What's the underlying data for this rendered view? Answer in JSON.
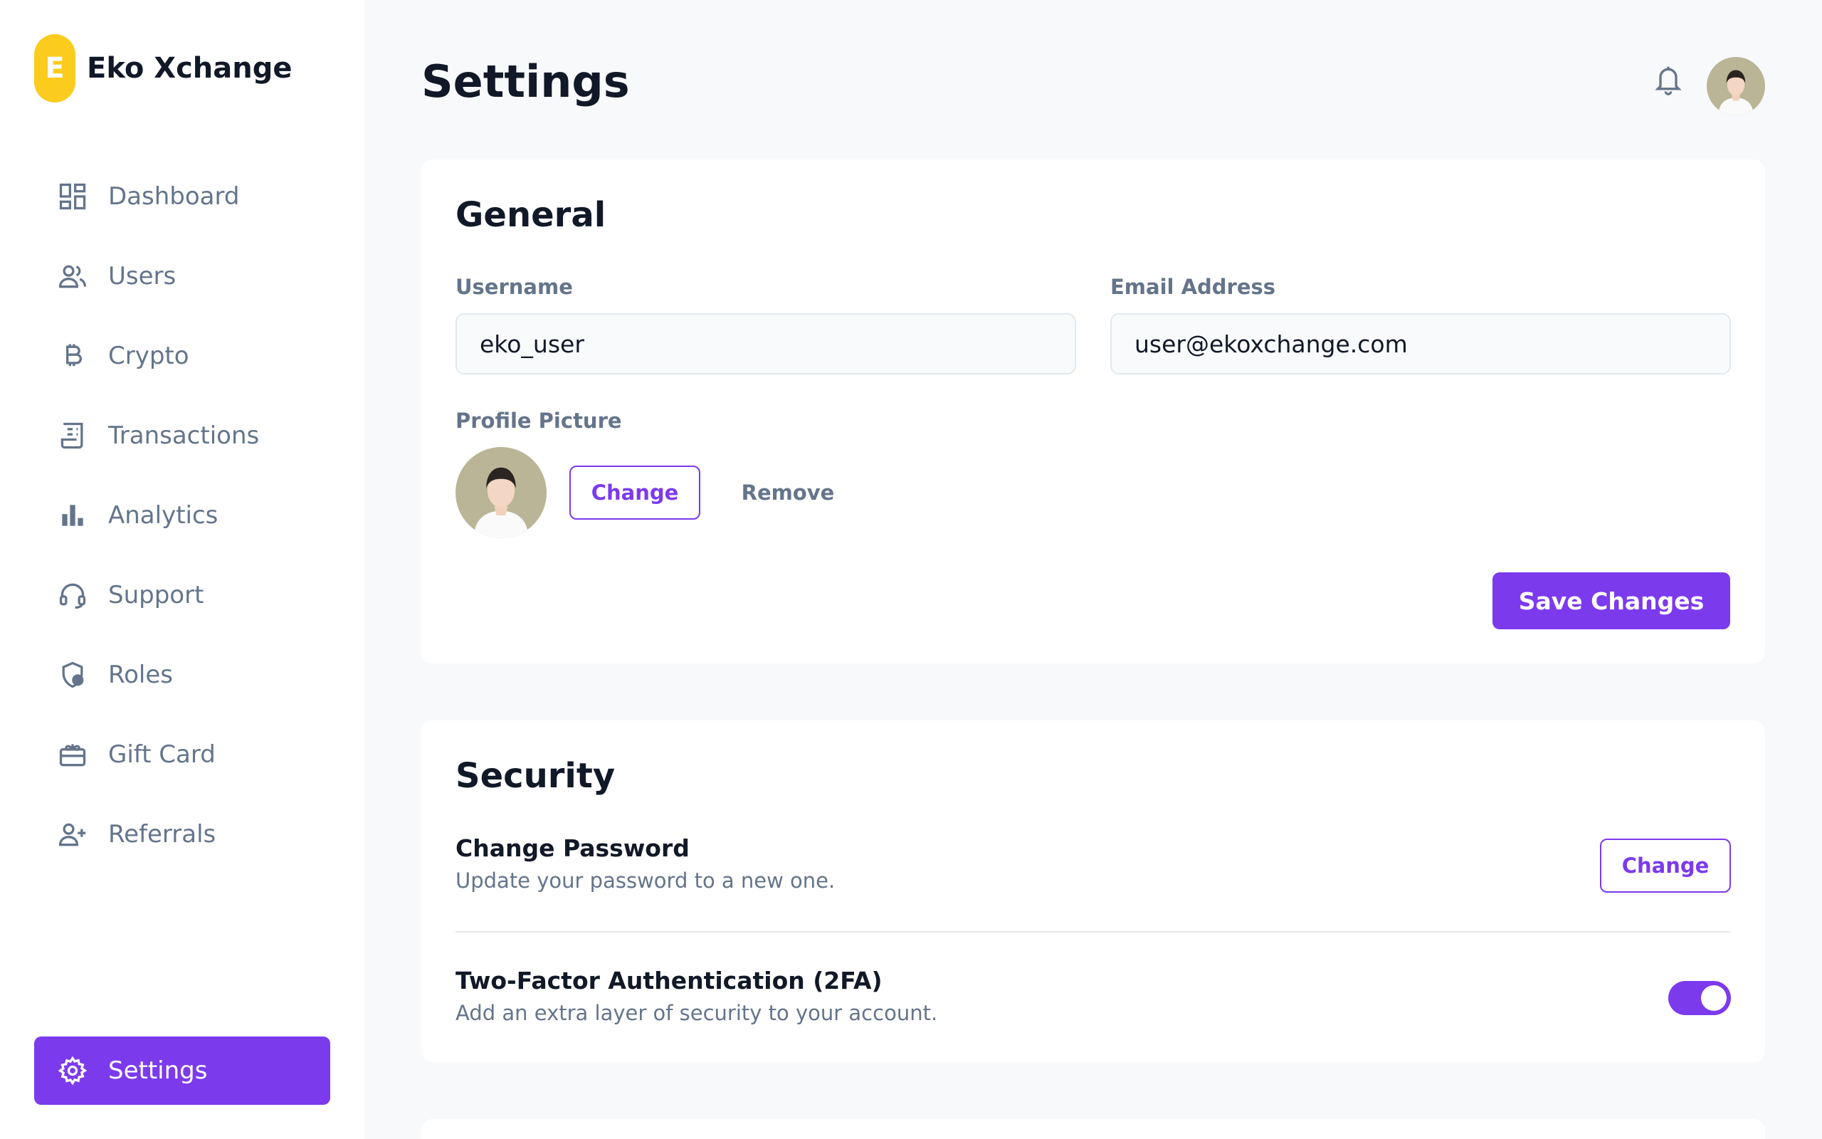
{
  "app": {
    "logo_letter": "E",
    "name": "Eko Xchange"
  },
  "sidebar": {
    "items": [
      {
        "label": "Dashboard",
        "icon": "dashboard-icon"
      },
      {
        "label": "Users",
        "icon": "users-icon"
      },
      {
        "label": "Crypto",
        "icon": "bitcoin-icon"
      },
      {
        "label": "Transactions",
        "icon": "receipt-icon"
      },
      {
        "label": "Analytics",
        "icon": "bar-chart-icon"
      },
      {
        "label": "Support",
        "icon": "headset-icon"
      },
      {
        "label": "Roles",
        "icon": "shield-user-icon"
      },
      {
        "label": "Gift Card",
        "icon": "gift-card-icon"
      },
      {
        "label": "Referrals",
        "icon": "user-plus-icon"
      }
    ],
    "active": {
      "label": "Settings",
      "icon": "gear-icon"
    }
  },
  "header": {
    "title": "Settings"
  },
  "general": {
    "title": "General",
    "username_label": "Username",
    "username_value": "eko_user",
    "email_label": "Email Address",
    "email_value": "user@ekoxchange.com",
    "profile_label": "Profile Picture",
    "change_label": "Change",
    "remove_label": "Remove",
    "save_label": "Save Changes"
  },
  "security": {
    "title": "Security",
    "password_title": "Change Password",
    "password_desc": "Update your password to a new one.",
    "password_button": "Change",
    "twofa_title": "Two-Factor Authentication (2FA)",
    "twofa_desc": "Add an extra layer of security to your account.",
    "twofa_enabled": true
  },
  "colors": {
    "accent": "#7c3aed",
    "logo": "#fbcc1d",
    "muted": "#64748b",
    "background": "#f8f9fb"
  }
}
